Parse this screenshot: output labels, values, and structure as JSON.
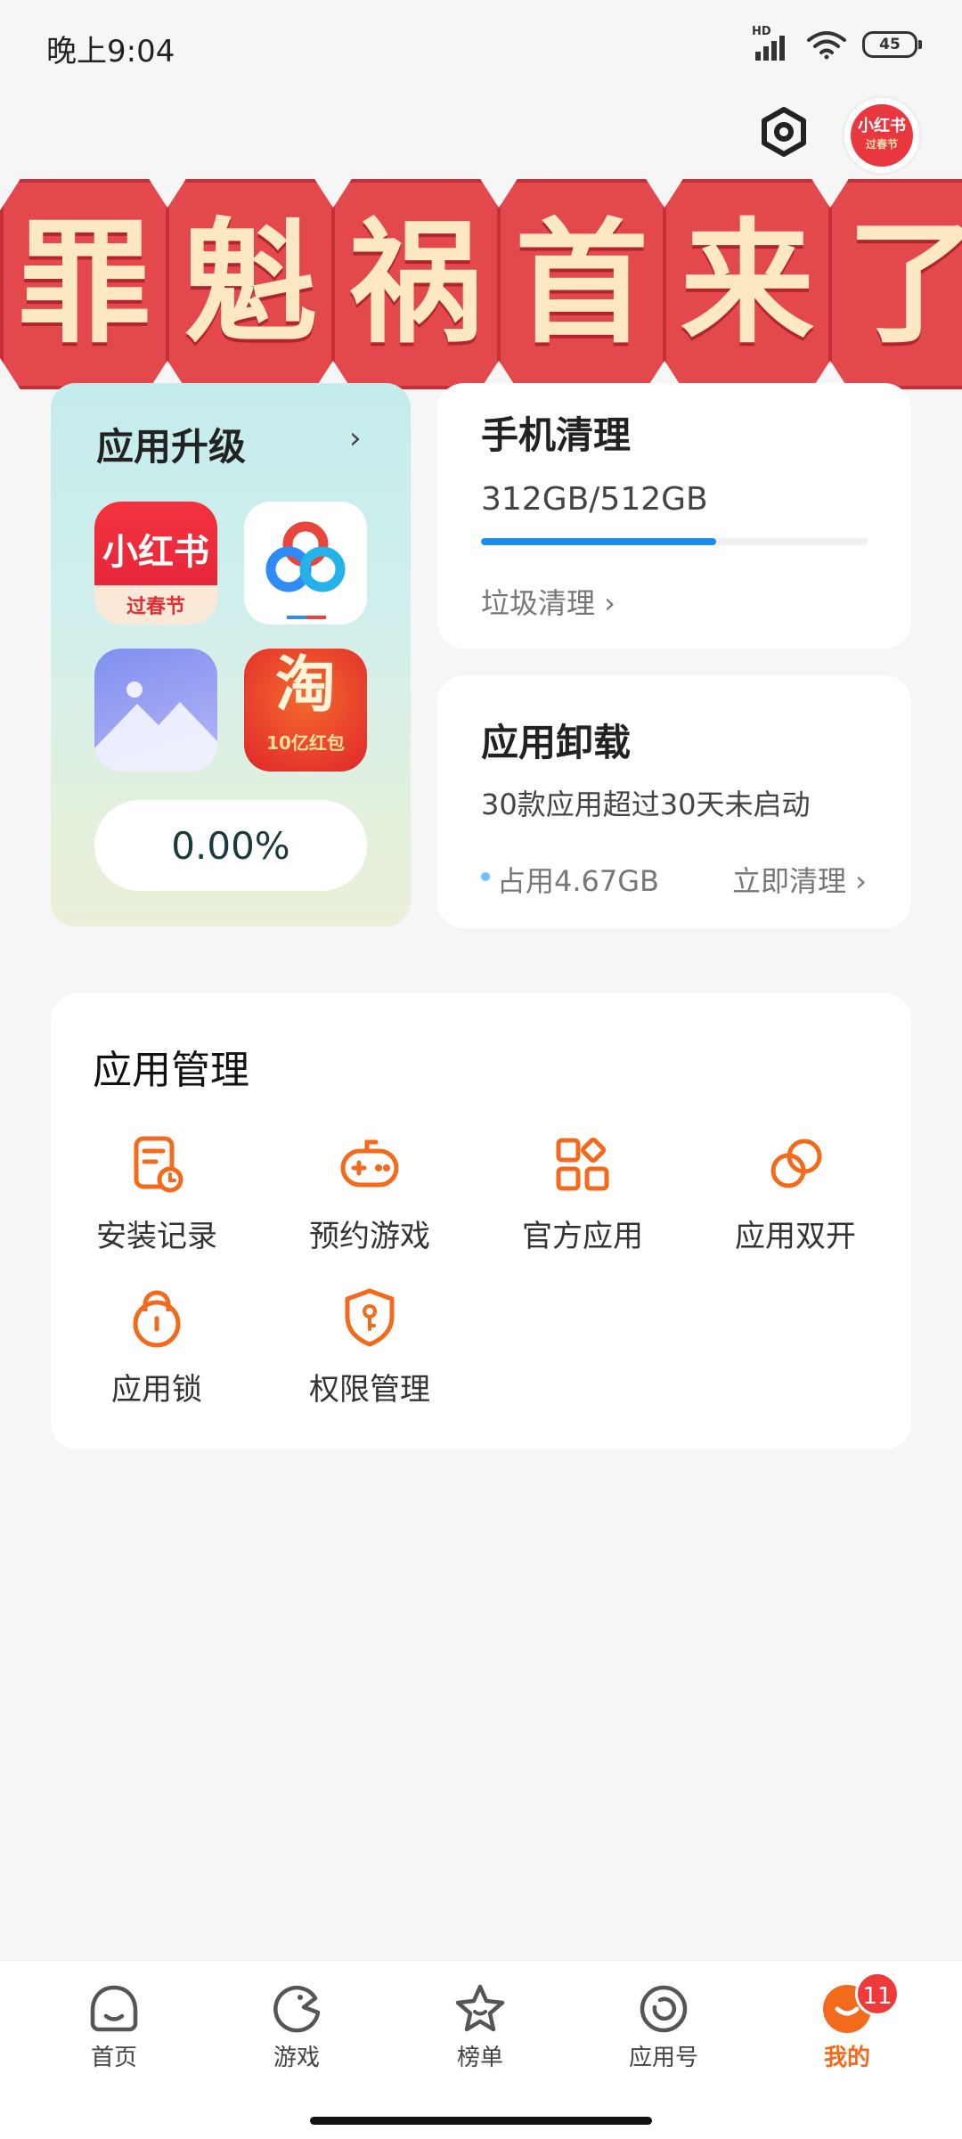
{
  "status_bar": {
    "time": "晚上9:04",
    "signal_label": "HD",
    "battery_level": "45"
  },
  "header": {
    "avatar_text": "小红书",
    "avatar_subtext": "过春节"
  },
  "banner": {
    "chars": [
      "罪",
      "魁",
      "祸",
      "首",
      "来",
      "了"
    ]
  },
  "upgrade_card": {
    "title": "应用升级",
    "arrow": "›",
    "apps": [
      {
        "name": "xiaohongshu-app",
        "line1": "小红书",
        "line2": "过春节"
      },
      {
        "name": "baidu-netdisk-app"
      },
      {
        "name": "gallery-app"
      },
      {
        "name": "taobao-app",
        "line1": "淘",
        "line2": "10亿红包"
      }
    ],
    "progress_text": "0.00%"
  },
  "clean_card": {
    "title": "手机清理",
    "storage": "312GB/512GB",
    "used_fraction": 0.609,
    "link": "垃圾清理 ›"
  },
  "uninstall_card": {
    "title": "应用卸载",
    "description": "30款应用超过30天未启动",
    "usage": "占用4.67GB",
    "action": "立即清理 ›"
  },
  "app_management": {
    "title": "应用管理",
    "items": [
      {
        "label": "安装记录",
        "icon": "install-record-icon"
      },
      {
        "label": "预约游戏",
        "icon": "gamepad-icon"
      },
      {
        "label": "官方应用",
        "icon": "apps-grid-icon"
      },
      {
        "label": "应用双开",
        "icon": "dual-app-icon"
      },
      {
        "label": "应用锁",
        "icon": "lock-icon"
      },
      {
        "label": "权限管理",
        "icon": "shield-key-icon"
      }
    ]
  },
  "bottom_nav": {
    "items": [
      {
        "label": "首页",
        "icon": "home-icon"
      },
      {
        "label": "游戏",
        "icon": "game-icon"
      },
      {
        "label": "榜单",
        "icon": "star-icon"
      },
      {
        "label": "应用号",
        "icon": "app-account-icon"
      },
      {
        "label": "我的",
        "icon": "profile-icon",
        "active": true
      }
    ],
    "badge_count": "11"
  },
  "colors": {
    "accent": "#f26a1b",
    "progress": "#1f8cf0",
    "banner": "#e2484c"
  }
}
